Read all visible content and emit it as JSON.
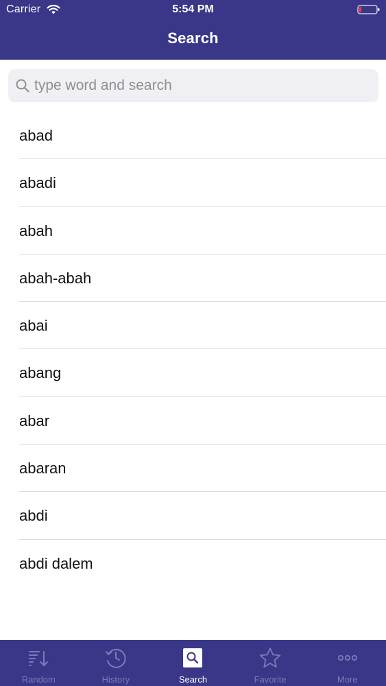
{
  "status_bar": {
    "carrier": "Carrier",
    "time": "5:54 PM"
  },
  "nav": {
    "title": "Search"
  },
  "search": {
    "placeholder": "type word and search",
    "value": ""
  },
  "words": [
    {
      "label": "abad"
    },
    {
      "label": "abadi"
    },
    {
      "label": "abah"
    },
    {
      "label": "abah-abah"
    },
    {
      "label": "abai"
    },
    {
      "label": "abang"
    },
    {
      "label": "abar"
    },
    {
      "label": "abaran"
    },
    {
      "label": "abdi"
    },
    {
      "label": "abdi dalem"
    }
  ],
  "tabs": [
    {
      "label": "Random",
      "icon": "random-sort-icon",
      "active": false
    },
    {
      "label": "History",
      "icon": "history-clock-icon",
      "active": false
    },
    {
      "label": "Search",
      "icon": "search-icon",
      "active": true
    },
    {
      "label": "Favorite",
      "icon": "star-icon",
      "active": false
    },
    {
      "label": "More",
      "icon": "more-dots-icon",
      "active": false
    }
  ],
  "colors": {
    "bar_background": "#3a3788",
    "tab_inactive": "#7c7ab8",
    "tab_active": "#ffffff",
    "battery_low": "#ff3b30",
    "search_field": "#efeff4"
  }
}
